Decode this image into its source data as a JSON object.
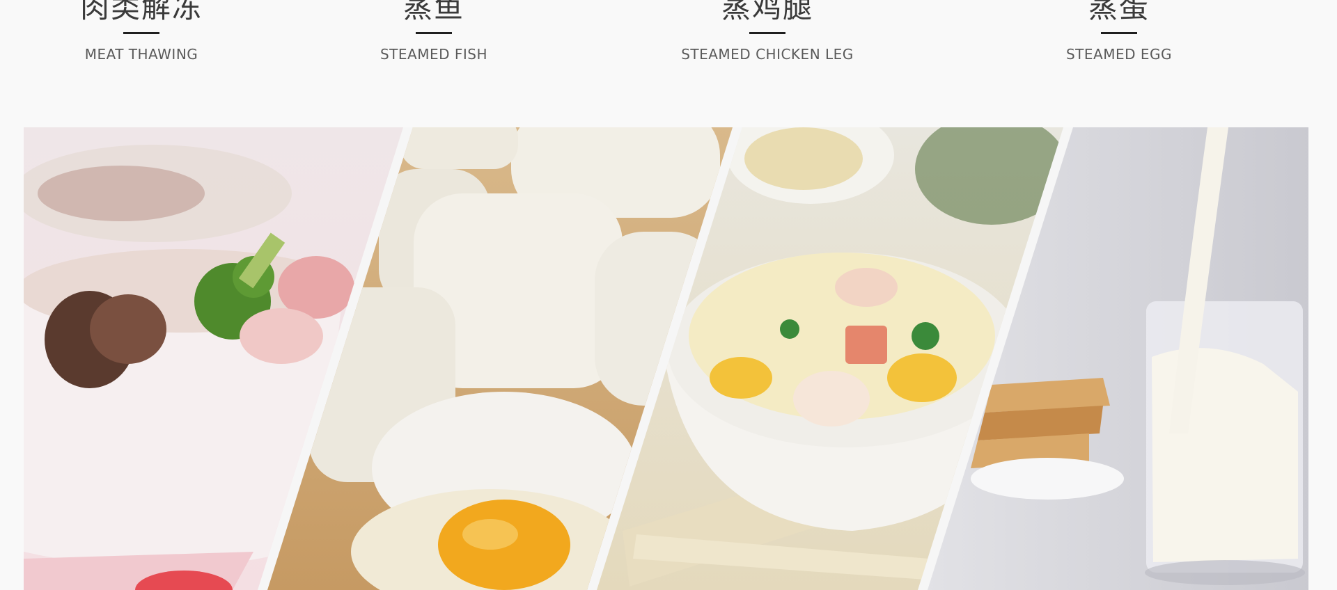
{
  "labels": [
    {
      "zh": "肉类解冻",
      "en": "MEAT THAWING"
    },
    {
      "zh": "蒸鱼",
      "en": "STEAMED FISH"
    },
    {
      "zh": "蒸鸡腿",
      "en": "STEAMED CHICKEN LEG"
    },
    {
      "zh": "蒸蛋",
      "en": "STEAMED EGG"
    }
  ],
  "photos": [
    {
      "subject": "bowl of rice with mushroom, broccoli and ham"
    },
    {
      "subject": "steamed buns with flour and raw egg"
    },
    {
      "subject": "bowl of fried rice with peas and shrimp"
    },
    {
      "subject": "glass of milk being poured with toast"
    }
  ]
}
